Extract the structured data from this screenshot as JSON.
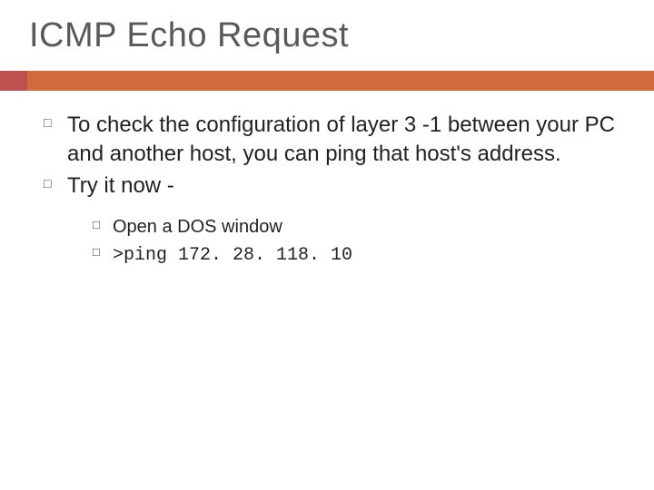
{
  "title": "ICMP Echo Request",
  "bullets": [
    "To check the configuration of layer 3 -1 between your PC and another host, you can ping that host's address.",
    "Try it now -"
  ],
  "sub_bullets": {
    "open_dos": "Open a DOS window",
    "cmd_text": ">ping 172. 28. 118. 10"
  }
}
